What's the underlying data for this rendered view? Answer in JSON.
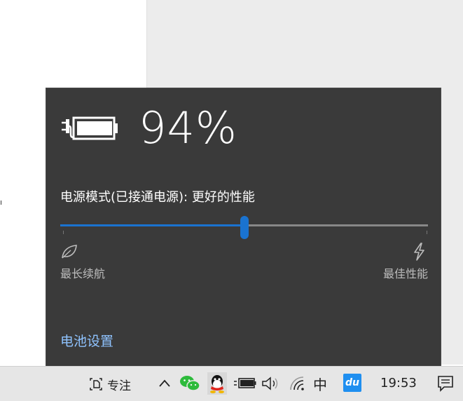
{
  "battery": {
    "percent_text": "94%",
    "plugged_in": true
  },
  "power_mode": {
    "label": "电源模式(已接通电源): 更好的性能",
    "slider_level": 0.5,
    "left_label": "最长续航",
    "right_label": "最佳性能",
    "left_icon": "leaf-icon",
    "right_icon": "lightning-icon"
  },
  "battery_settings_link": "电池设置",
  "taskbar": {
    "focus_label": "专注",
    "ime_label": "中",
    "baidu_label": "du",
    "clock": "19:53",
    "icons": [
      "focus-assist-icon",
      "chevron-up-icon",
      "wechat-icon",
      "qq-icon",
      "battery-icon",
      "speaker-icon",
      "wifi-icon",
      "action-center-icon"
    ]
  },
  "colors": {
    "flyout_bg": "#3a3a3a",
    "accent": "#1a73d0",
    "link": "#8fc3ff",
    "track": "#888888",
    "taskbar_bg": "#e6e6e6"
  }
}
